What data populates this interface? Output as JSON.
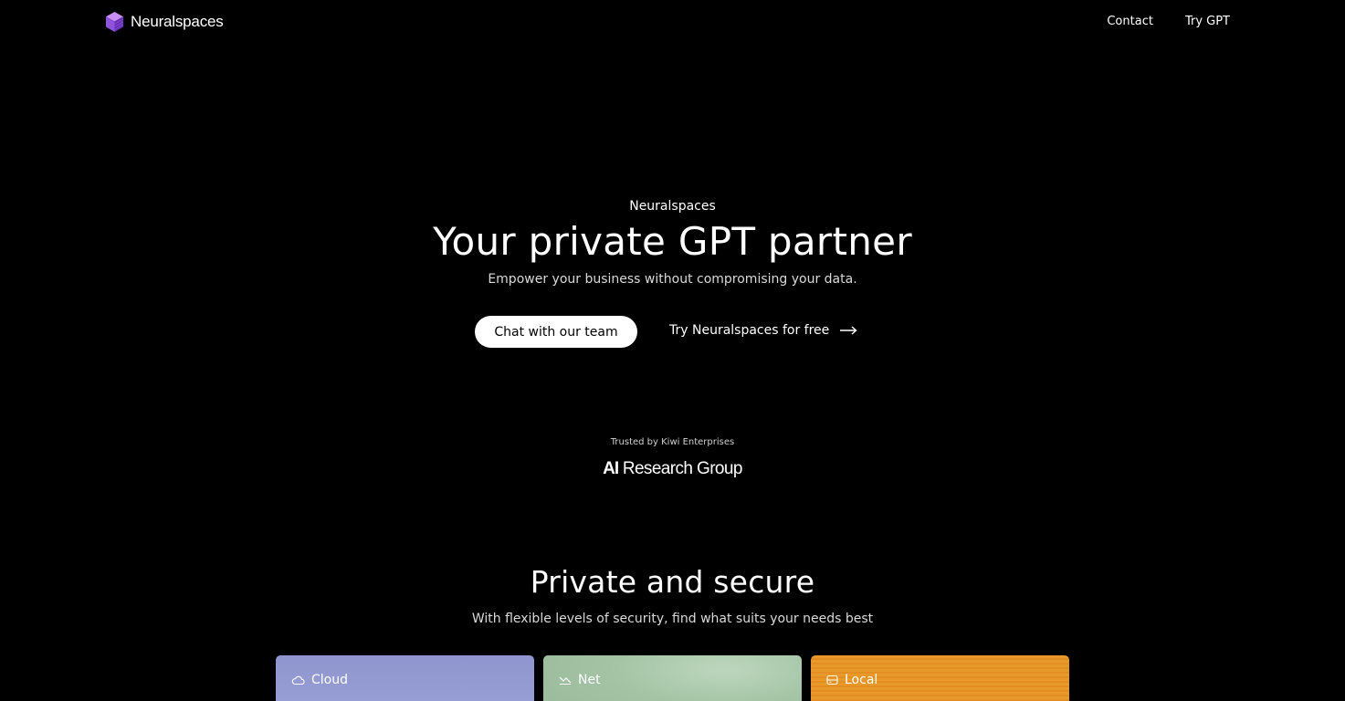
{
  "nav": {
    "brand": "Neuralspaces",
    "links": [
      "Contact",
      "Try GPT"
    ]
  },
  "hero": {
    "eyebrow": "Neuralspaces",
    "headline": "Your private GPT partner",
    "subhead": "Empower your business without compromising your data.",
    "cta_primary": "Chat with our team",
    "cta_secondary": "Try Neuralspaces for free"
  },
  "trust": {
    "label": "Trusted by Kiwi Enterprises",
    "partner_ai": "AI",
    "partner_rest": " Research Group"
  },
  "security": {
    "title": "Private and secure",
    "subtitle": "With flexible levels of security, find what suits your needs best",
    "cards": [
      {
        "label": "Cloud",
        "icon": "cloud-icon",
        "color": "#959dd3"
      },
      {
        "label": "Net",
        "icon": "network-icon",
        "color": "#a6c4a7"
      },
      {
        "label": "Local",
        "icon": "server-icon",
        "color": "#e6962a"
      }
    ]
  },
  "colors": {
    "background": "#000000",
    "text": "#ffffff",
    "logo_purple": "#8a4fd8"
  }
}
